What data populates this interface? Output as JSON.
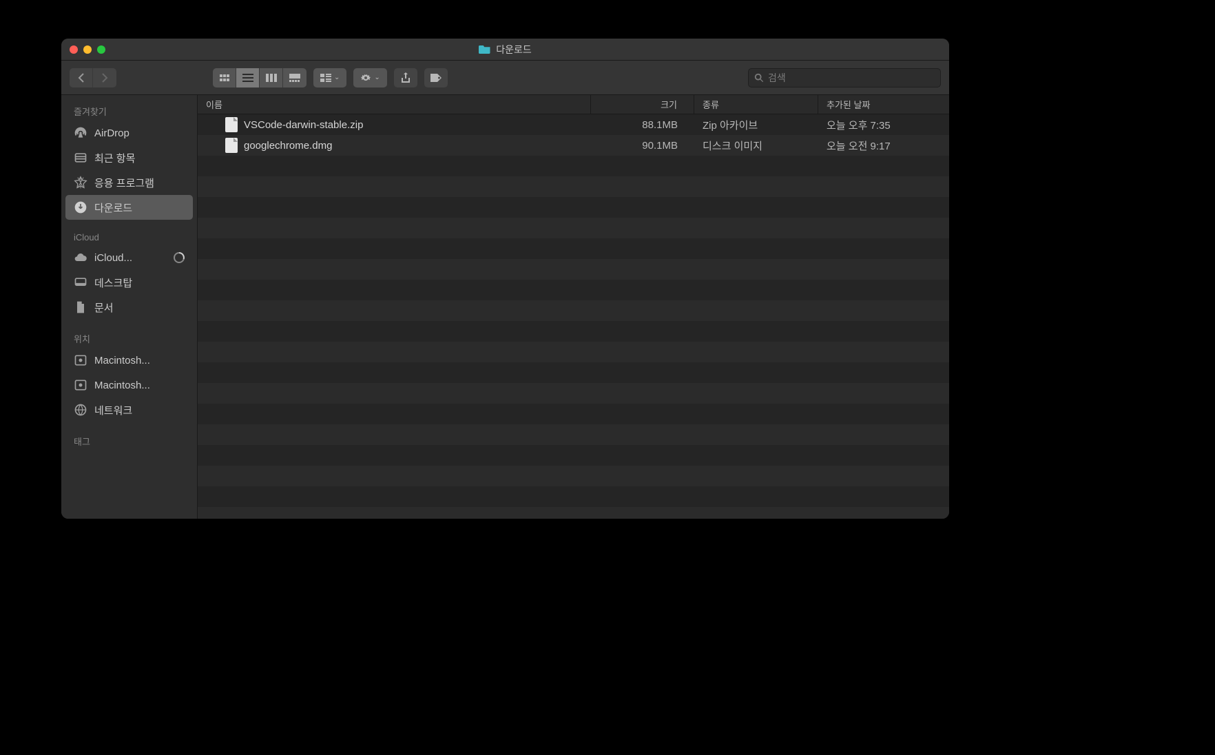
{
  "window": {
    "title": "다운로드"
  },
  "search": {
    "placeholder": "검색"
  },
  "sidebar": {
    "section_favorites": "즐겨찾기",
    "section_icloud": "iCloud",
    "section_locations": "위치",
    "section_tags": "태그",
    "favorites": [
      {
        "label": "AirDrop",
        "icon": "airdrop"
      },
      {
        "label": "최근 항목",
        "icon": "recents"
      },
      {
        "label": "응용 프로그램",
        "icon": "apps"
      },
      {
        "label": "다운로드",
        "icon": "downloads",
        "selected": true
      }
    ],
    "icloud": [
      {
        "label": "iCloud...",
        "icon": "cloud",
        "trailing": "progress"
      },
      {
        "label": "데스크탑",
        "icon": "desktop"
      },
      {
        "label": "문서",
        "icon": "documents"
      }
    ],
    "locations": [
      {
        "label": "Macintosh...",
        "icon": "disk"
      },
      {
        "label": "Macintosh...",
        "icon": "disk-system"
      },
      {
        "label": "네트워크",
        "icon": "network"
      }
    ]
  },
  "columns": {
    "name": "이름",
    "size": "크기",
    "kind": "종류",
    "date_added": "추가된 날짜"
  },
  "files": [
    {
      "name": "VSCode-darwin-stable.zip",
      "size": "88.1MB",
      "kind": "Zip 아카이브",
      "date": "오늘 오후 7:35"
    },
    {
      "name": "googlechrome.dmg",
      "size": "90.1MB",
      "kind": "디스크 이미지",
      "date": "오늘 오전 9:17"
    }
  ]
}
